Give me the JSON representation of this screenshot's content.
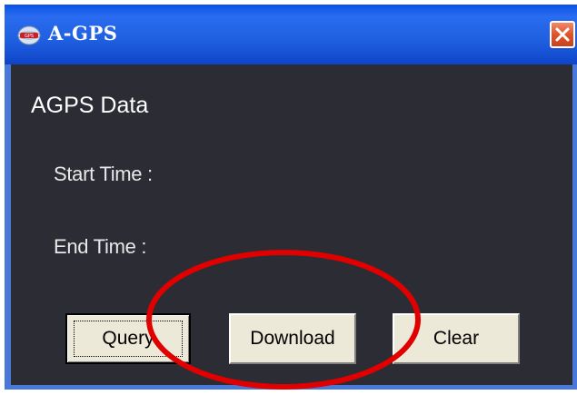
{
  "window": {
    "title": "A-GPS",
    "app_icon": "agps-globe-icon",
    "close_icon": "close-icon",
    "title_bar_color": "#1f5fe0",
    "close_button_color": "#e0532c",
    "background_color": "#2b2c34"
  },
  "content": {
    "heading": "AGPS Data",
    "start_time_label": "Start Time :",
    "end_time_label": "End Time :"
  },
  "buttons": {
    "query": "Query",
    "download": "Download",
    "clear": "Clear"
  },
  "annotation": {
    "shape": "ellipse",
    "color": "#e00000",
    "highlights": "Download"
  }
}
